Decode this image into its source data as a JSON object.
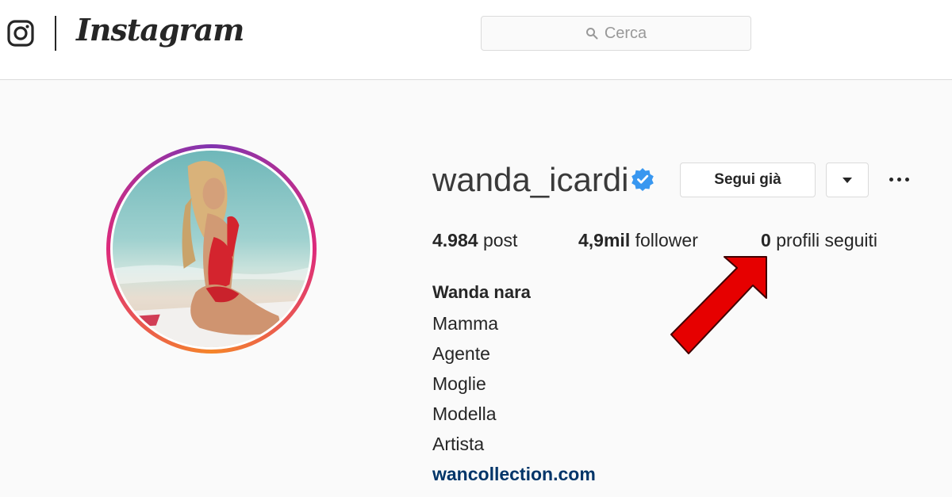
{
  "app": {
    "wordmark": "Instagram"
  },
  "header": {
    "search_placeholder": "Cerca"
  },
  "profile": {
    "username": "wanda_icardi",
    "follow_button_label": "Segui già",
    "stats": [
      {
        "value": "4.984",
        "label": "post"
      },
      {
        "value": "4,9mil",
        "label": "follower"
      },
      {
        "value": "0",
        "label": "profili seguiti"
      }
    ],
    "bio": {
      "name": "Wanda nara",
      "lines": [
        "Mamma",
        "Agente",
        "Moglie",
        "Modella",
        "Artista"
      ],
      "link": "wancollection.com"
    }
  },
  "icons": {
    "logo": "instagram-glyph-icon",
    "search": "search-icon",
    "verified": "verified-badge-icon",
    "dropdown": "chevron-down-icon",
    "more": "more-options-icon",
    "annotation": "red-arrow-icon"
  },
  "colors": {
    "verified": "#3897f0",
    "link": "#003569",
    "arrow": "#e60000",
    "border": "#dbdbdb"
  }
}
